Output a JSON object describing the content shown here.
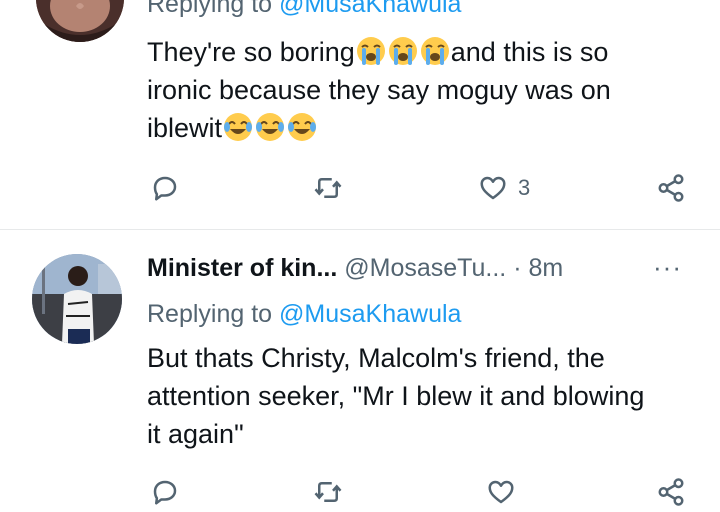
{
  "tweets": [
    {
      "reply_label": "Replying to",
      "reply_handle": "@MusaKhawula",
      "text_lines": [
        "They're so boring",
        "and this is so",
        "ironic because they say moguy was on",
        "iblewit"
      ],
      "emoji_1": "loudly-crying-face-emoji",
      "emoji_2": "face-with-tears-of-joy-emoji",
      "like_count": "3"
    },
    {
      "name": "Minister of kin...",
      "handle": "@MosaseTu...",
      "separator": "·",
      "time": "8m",
      "more": "···",
      "reply_label": "Replying to",
      "reply_handle": "@MusaKhawula",
      "text_lines": [
        "But thats Christy, Malcolm's friend, the",
        "attention seeker, \"Mr I blew it and blowing",
        "it again\""
      ]
    }
  ],
  "icons": {
    "reply": "reply-icon",
    "retweet": "retweet-icon",
    "like": "heart-icon",
    "share": "share-icon"
  },
  "colors": {
    "text": "#0f1419",
    "muted": "#536471",
    "link": "#1d9bf0",
    "divider": "#e7e9ea"
  }
}
